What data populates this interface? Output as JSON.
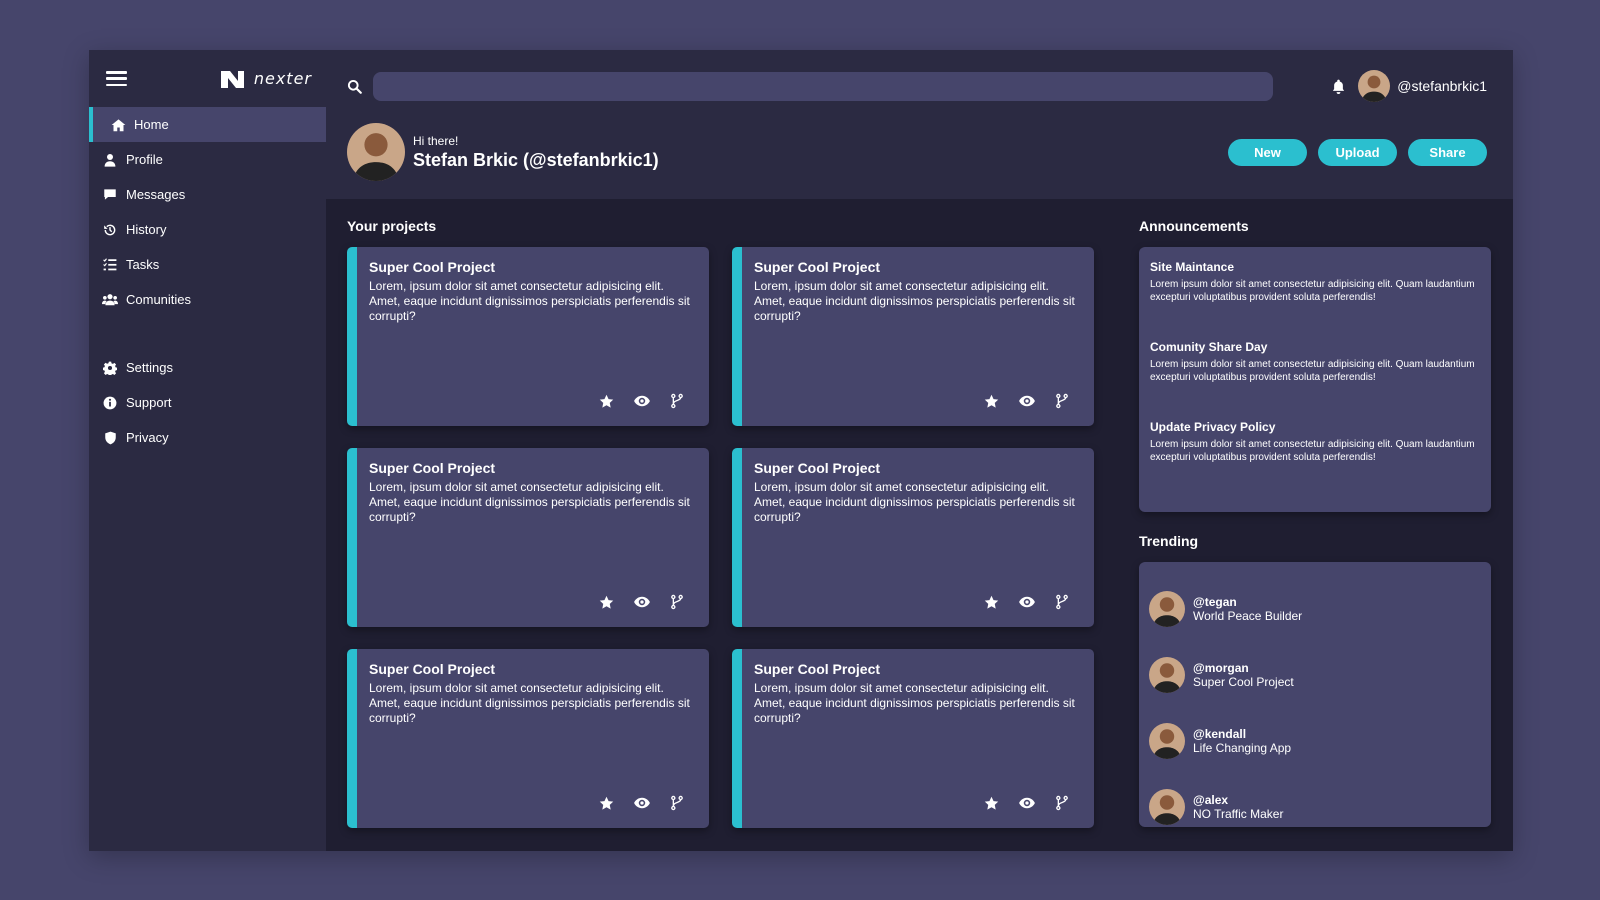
{
  "brand": {
    "logo_text": "nexter"
  },
  "sidebar": {
    "items": [
      {
        "label": "Home",
        "icon": "home-icon"
      },
      {
        "label": "Profile",
        "icon": "user-icon"
      },
      {
        "label": "Messages",
        "icon": "message-icon"
      },
      {
        "label": "History",
        "icon": "history-icon"
      },
      {
        "label": "Tasks",
        "icon": "tasks-icon"
      },
      {
        "label": "Comunities",
        "icon": "users-icon"
      }
    ],
    "secondary": [
      {
        "label": "Settings",
        "icon": "gear-icon"
      },
      {
        "label": "Support",
        "icon": "info-icon"
      },
      {
        "label": "Privacy",
        "icon": "shield-icon"
      }
    ]
  },
  "header": {
    "search": {
      "value": "",
      "placeholder": ""
    },
    "username": "@stefanbrkic1",
    "greeting": "Hi there!",
    "full_name": "Stefan Brkic (@stefanbrkic1)",
    "buttons": {
      "new": "New",
      "upload": "Upload",
      "share": "Share"
    }
  },
  "projects": {
    "title": "Your projects",
    "cards": [
      {
        "title": "Super Cool Project",
        "text": "Lorem, ipsum dolor sit amet consectetur adipisicing elit. Amet, eaque incidunt dignissimos perspiciatis perferendis sit corrupti?"
      },
      {
        "title": "Super Cool Project",
        "text": "Lorem, ipsum dolor sit amet consectetur adipisicing elit. Amet, eaque incidunt dignissimos perspiciatis perferendis sit corrupti?"
      },
      {
        "title": "Super Cool Project",
        "text": "Lorem, ipsum dolor sit amet consectetur adipisicing elit. Amet, eaque incidunt dignissimos perspiciatis perferendis sit corrupti?"
      },
      {
        "title": "Super Cool Project",
        "text": "Lorem, ipsum dolor sit amet consectetur adipisicing elit. Amet, eaque incidunt dignissimos perspiciatis perferendis sit corrupti?"
      },
      {
        "title": "Super Cool Project",
        "text": "Lorem, ipsum dolor sit amet consectetur adipisicing elit. Amet, eaque incidunt dignissimos perspiciatis perferendis sit corrupti?"
      },
      {
        "title": "Super Cool Project",
        "text": "Lorem, ipsum dolor sit amet consectetur adipisicing elit. Amet, eaque incidunt dignissimos perspiciatis perferendis sit corrupti?"
      }
    ]
  },
  "announcements": {
    "title": "Announcements",
    "items": [
      {
        "title": "Site Maintance",
        "text": "Lorem ipsum dolor sit amet consectetur adipisicing elit. Quam laudantium excepturi voluptatibus provident soluta perferendis!"
      },
      {
        "title": "Comunity Share Day",
        "text": "Lorem ipsum dolor sit amet consectetur adipisicing elit. Quam laudantium excepturi voluptatibus provident soluta perferendis!"
      },
      {
        "title": "Update Privacy Policy",
        "text": "Lorem ipsum dolor sit amet consectetur adipisicing elit. Quam laudantium excepturi voluptatibus provident soluta perferendis!"
      }
    ]
  },
  "trending": {
    "title": "Trending",
    "items": [
      {
        "handle": "@tegan",
        "project": "World Peace Builder"
      },
      {
        "handle": "@morgan",
        "project": "Super Cool Project"
      },
      {
        "handle": "@kendall",
        "project": "Life Changing App"
      },
      {
        "handle": "@alex",
        "project": "NO Traffic Maker"
      }
    ]
  },
  "colors": {
    "accent": "#2bbfcf",
    "background": "#46456b",
    "panel": "#2b2a42",
    "content": "#1f1e31"
  }
}
